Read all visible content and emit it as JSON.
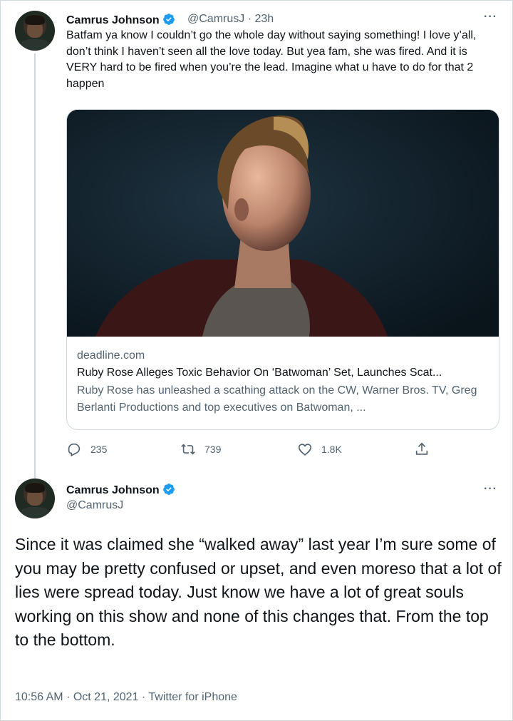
{
  "tweet1": {
    "name": "Camrus Johnson",
    "handle": "@CamrusJ",
    "separator": "·",
    "time": "23h",
    "text": "Batfam ya know I couldn’t go the whole day without saying something! I love y’all, don’t think I haven’t seen all the love today. But yea fam, she was fired. And it is VERY hard to be fired when you’re the lead. Imagine what u have to do for that 2 happen",
    "more": "···",
    "card": {
      "domain": "deadline.com",
      "title": "Ruby Rose Alleges Toxic Behavior On ‘Batwoman’ Set, Launches Scat...",
      "description": "Ruby Rose has unleashed a scathing attack on the CW, Warner Bros. TV, Greg Berlanti Productions and top executives on Batwoman, ..."
    },
    "actions": {
      "replies": "235",
      "retweets": "739",
      "likes": "1.8K"
    }
  },
  "tweet2": {
    "name": "Camrus Johnson",
    "handle": "@CamrusJ",
    "more": "···",
    "text": "Since it was claimed she “walked away” last year I’m sure some of you may be pretty confused or upset, and even moreso that a lot of lies were spread today. Just know we have a lot of great souls working on this show and none of this changes that. From the top to the bottom.",
    "time": "10:56 AM",
    "date": "Oct 21, 2021",
    "source": "Twitter for iPhone",
    "separator": "·"
  },
  "colors": {
    "verified": "#1d9bf0",
    "muted": "#536471",
    "text": "#0f1419",
    "border": "#cfd9de"
  },
  "icons": [
    "verified-badge-icon",
    "reply-icon",
    "retweet-icon",
    "like-icon",
    "share-icon",
    "more-icon"
  ]
}
